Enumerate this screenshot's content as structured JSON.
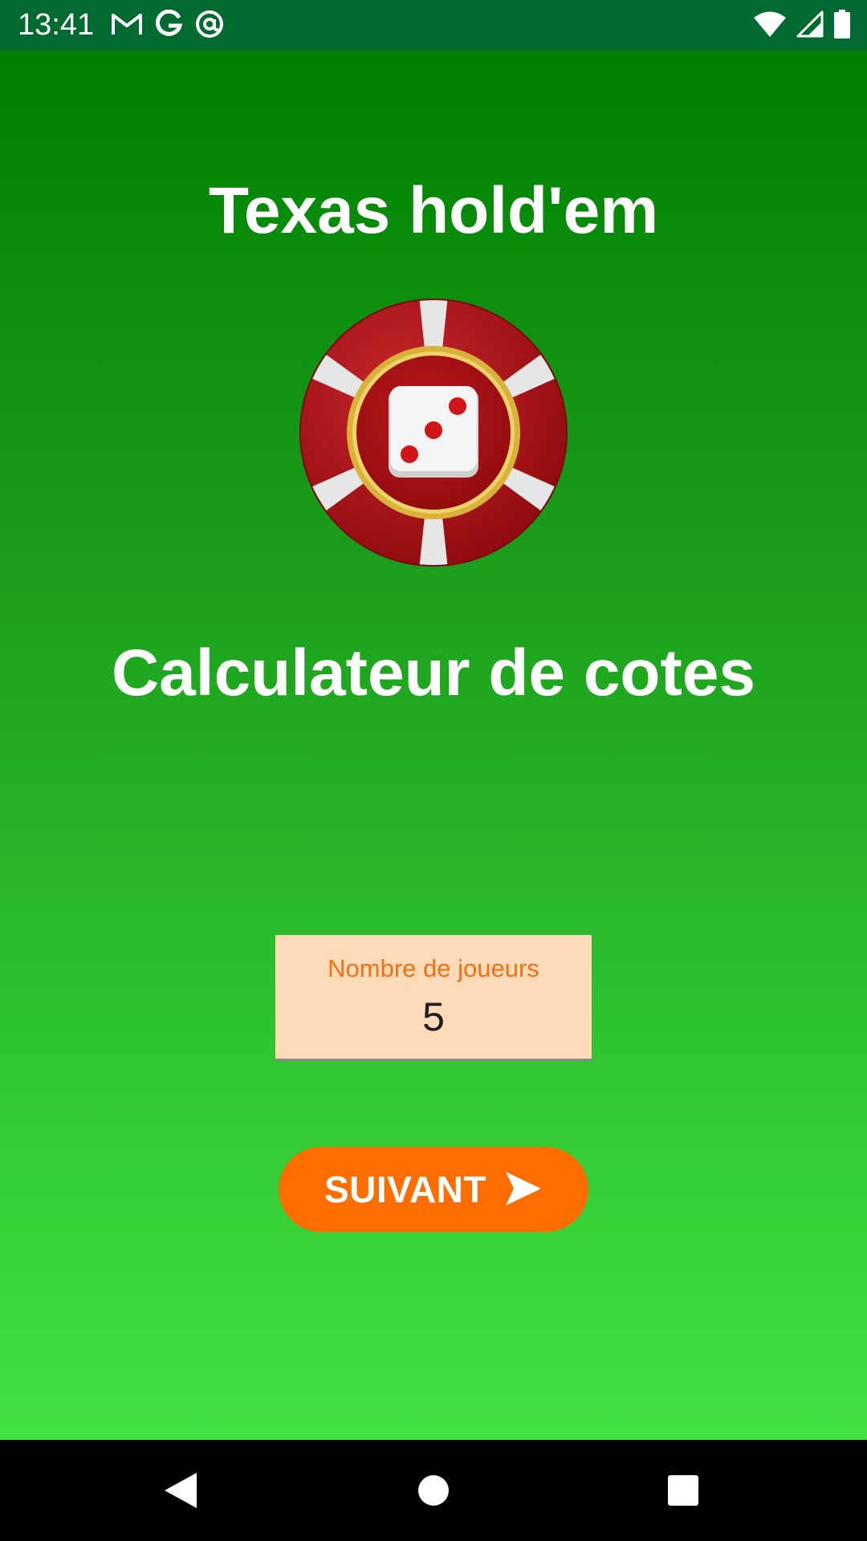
{
  "status_bar": {
    "time": "13:41",
    "left_icons": [
      "gmail-icon",
      "google-icon",
      "at-sign-icon"
    ],
    "right_icons": [
      "wifi-icon",
      "cell-signal-icon",
      "battery-icon"
    ]
  },
  "app": {
    "title": "Texas hold'em",
    "logo_icon": "poker-chip-dice-icon",
    "subtitle": "Calculateur de cotes",
    "players_field": {
      "label": "Nombre de joueurs",
      "value": "5"
    },
    "next_button": {
      "label": "SUIVANT",
      "icon": "send-arrow-icon"
    }
  },
  "nav_bar": {
    "buttons": [
      "back-icon",
      "home-icon",
      "recents-icon"
    ]
  },
  "colors": {
    "status_bar_bg": "#006a30",
    "gradient_top": "#008000",
    "gradient_bottom": "#42e142",
    "field_bg": "#fedbb8",
    "field_label": "#f07013",
    "button_bg": "#fe6d00",
    "chip_red": "#a80c10"
  }
}
